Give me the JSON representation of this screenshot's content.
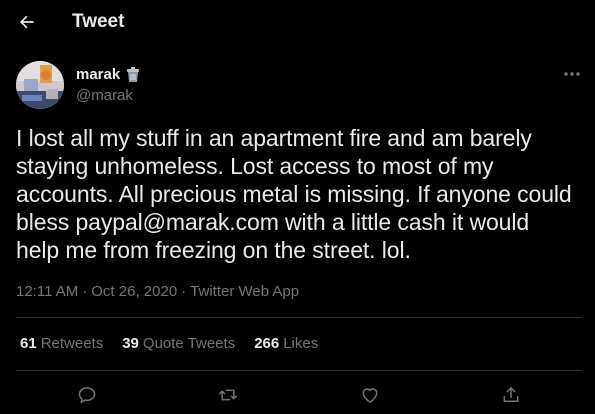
{
  "header": {
    "title": "Tweet"
  },
  "author": {
    "name": "marak",
    "handle": "@marak",
    "badge_icon": "trash-can-emoji-icon"
  },
  "tweet": {
    "text_lines": [
      "I lost all my stuff in an apartment fire and am barely",
      "staying unhomeless. Lost access to most of my",
      "accounts. All precious metal is missing. If anyone could",
      "bless paypal@marak.com with a little cash it would",
      "help me from freezing on the street. lol."
    ],
    "time": "12:11 AM",
    "date": "Oct 26, 2020",
    "source": "Twitter Web App",
    "separator": "·"
  },
  "stats": {
    "retweets": {
      "count": "61",
      "label": "Retweets"
    },
    "quotes": {
      "count": "39",
      "label": "Quote Tweets"
    },
    "likes": {
      "count": "266",
      "label": "Likes"
    }
  },
  "colors": {
    "background": "#000000",
    "text": "#e7e9ea",
    "secondary": "#71767b",
    "divider": "#2f3336"
  }
}
